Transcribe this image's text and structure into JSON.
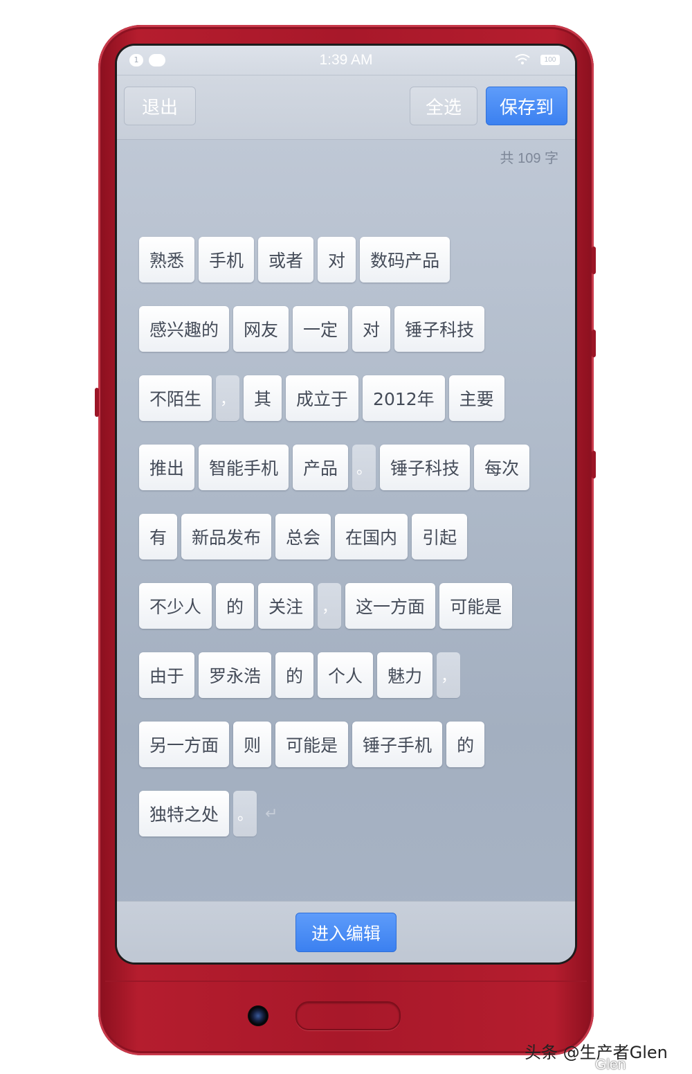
{
  "status_bar": {
    "time": "1:39 AM",
    "notification_count": "1",
    "battery": "100"
  },
  "toolbar": {
    "exit_label": "退出",
    "select_all_label": "全选",
    "save_label": "保存到"
  },
  "word_count": "共 109 字",
  "rows": [
    [
      {
        "t": "熟悉"
      },
      {
        "t": "手机"
      },
      {
        "t": "或者"
      },
      {
        "t": "对"
      },
      {
        "t": "数码产品"
      }
    ],
    [
      {
        "t": "感兴趣的"
      },
      {
        "t": "网友"
      },
      {
        "t": "一定"
      },
      {
        "t": "对"
      },
      {
        "t": "锤子科技"
      }
    ],
    [
      {
        "t": "不陌生"
      },
      {
        "t": "，",
        "p": true
      },
      {
        "t": "其"
      },
      {
        "t": "成立于"
      },
      {
        "t": "2012年"
      },
      {
        "t": "主要"
      }
    ],
    [
      {
        "t": "推出"
      },
      {
        "t": "智能手机"
      },
      {
        "t": "产品"
      },
      {
        "t": "。",
        "p": true
      },
      {
        "t": "锤子科技"
      },
      {
        "t": "每次"
      }
    ],
    [
      {
        "t": "有"
      },
      {
        "t": "新品发布"
      },
      {
        "t": "总会"
      },
      {
        "t": "在国内"
      },
      {
        "t": "引起"
      }
    ],
    [
      {
        "t": "不少人"
      },
      {
        "t": "的"
      },
      {
        "t": "关注"
      },
      {
        "t": "，",
        "p": true
      },
      {
        "t": "这一方面"
      },
      {
        "t": "可能是"
      }
    ],
    [
      {
        "t": "由于"
      },
      {
        "t": "罗永浩"
      },
      {
        "t": "的"
      },
      {
        "t": "个人"
      },
      {
        "t": "魅力"
      },
      {
        "t": "，",
        "p": true
      }
    ],
    [
      {
        "t": "另一方面"
      },
      {
        "t": "则"
      },
      {
        "t": "可能是"
      },
      {
        "t": "锤子手机"
      },
      {
        "t": "的"
      }
    ],
    [
      {
        "t": "独特之处"
      },
      {
        "t": "。",
        "p": true
      }
    ]
  ],
  "return_symbol": "↵",
  "bottom": {
    "edit_label": "进入编辑"
  },
  "watermark": {
    "line1": "头条 @生产者Glen",
    "line2": "Glen"
  },
  "colors": {
    "phone_red": "#a8182a",
    "accent_blue": "#3b80f0"
  }
}
